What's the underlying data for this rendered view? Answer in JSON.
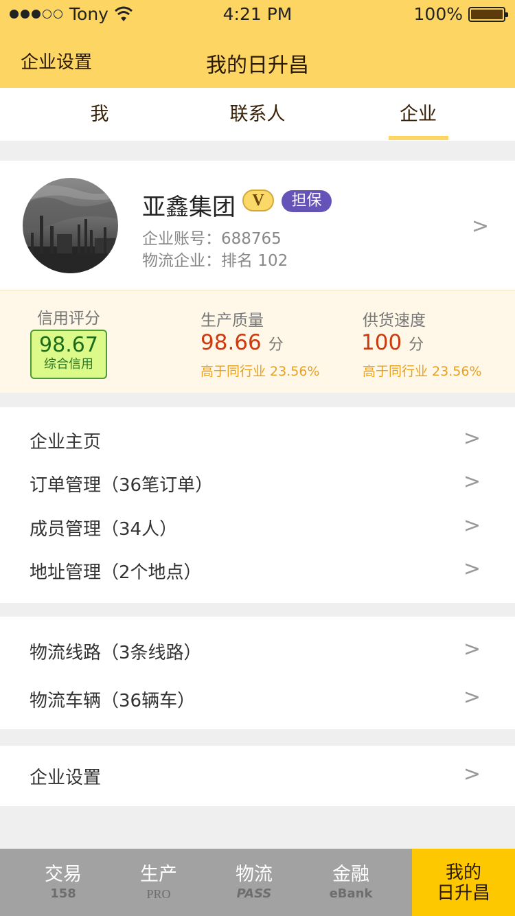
{
  "status_bar": {
    "carrier": "Tony",
    "time": "4:21 PM",
    "battery": "100%"
  },
  "nav": {
    "left_label": "企业设置",
    "title": "我的日升昌"
  },
  "tabs": [
    {
      "label": "我"
    },
    {
      "label": "联系人"
    },
    {
      "label": "企业"
    }
  ],
  "profile": {
    "name": "亚鑫集团",
    "badge_v": "V",
    "badge_guarantee": "担保",
    "account": "企业账号：688765",
    "category_rank": "物流企业：排名 102",
    "chevron": ">"
  },
  "stats": {
    "credit": {
      "label": "信用评分",
      "value": "98.67",
      "sub": "综合信用"
    },
    "quality": {
      "label": "生产质量",
      "value": "98.66",
      "unit": "分",
      "compare": "高于同行业 23.56%"
    },
    "speed": {
      "label": "供货速度",
      "value": "100",
      "unit": "分",
      "compare": "高于同行业 23.56%"
    }
  },
  "menu_group_1": [
    {
      "label": "企业主页"
    },
    {
      "label": "订单管理（36笔订单）"
    },
    {
      "label": "成员管理（34人）"
    },
    {
      "label": "地址管理（2个地点）"
    }
  ],
  "menu_group_2": [
    {
      "label": "物流线路（3条线路）"
    },
    {
      "label": "物流车辆（36辆车）"
    }
  ],
  "menu_group_3": [
    {
      "label": "企业设置"
    }
  ],
  "chevron": ">",
  "tabbar": [
    {
      "main": "交易",
      "sub": "158"
    },
    {
      "main": "生产",
      "sub": "PRO"
    },
    {
      "main": "物流",
      "sub": "PASS"
    },
    {
      "main": "金融",
      "sub": "eBank"
    },
    {
      "main": "我的",
      "sub": "日升昌"
    }
  ],
  "colors": {
    "brand": "#fdd563",
    "active_tab": "#fdc800",
    "accent_red": "#cc3a10",
    "compare_orange": "#e8a020",
    "credit_green": "#dcfa8a",
    "guarantee_purple": "#6553b8"
  }
}
